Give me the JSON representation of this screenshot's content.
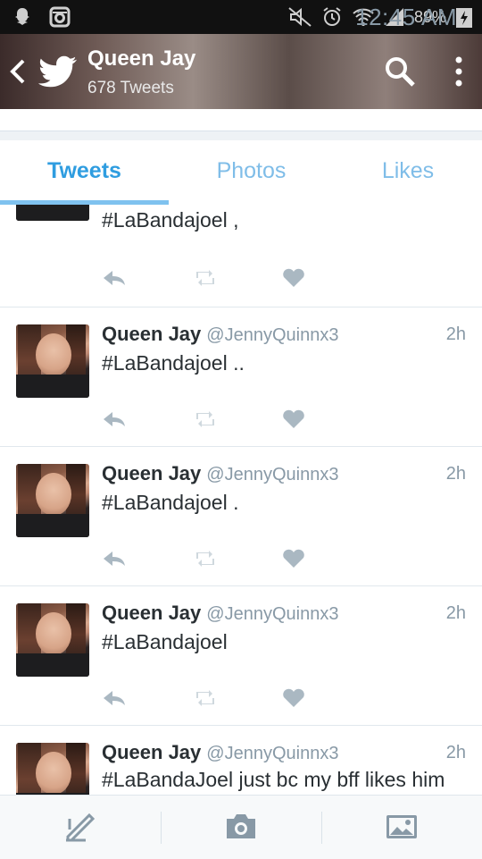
{
  "statusbar": {
    "battery": "89%",
    "time": "12:45 AM"
  },
  "header": {
    "title": "Queen Jay",
    "tweet_count": "678 Tweets"
  },
  "tabs": [
    {
      "label": "Tweets",
      "active": true
    },
    {
      "label": "Photos",
      "active": false
    },
    {
      "label": "Likes",
      "active": false
    }
  ],
  "tweets": [
    {
      "name": "",
      "handle": "",
      "time": "",
      "text": "#LaBandajoel ,"
    },
    {
      "name": "Queen Jay",
      "handle": "@JennyQuinnx3",
      "time": "2h",
      "text": "#LaBandajoel .."
    },
    {
      "name": "Queen Jay",
      "handle": "@JennyQuinnx3",
      "time": "2h",
      "text": "#LaBandajoel ."
    },
    {
      "name": "Queen Jay",
      "handle": "@JennyQuinnx3",
      "time": "2h",
      "text": "#LaBandajoel"
    },
    {
      "name": "Queen Jay",
      "handle": "@JennyQuinnx3",
      "time": "2h",
      "text": "#LaBandaJoel just bc my bff likes him"
    }
  ],
  "icons": {
    "status_left": [
      "snapchat-icon",
      "instagram-icon"
    ],
    "status_right": [
      "mute-icon",
      "alarm-icon",
      "wifi-icon",
      "signal-icon",
      "battery-charging-icon"
    ],
    "header": [
      "back-arrow-icon",
      "twitter-bird-icon",
      "search-icon",
      "more-vert-icon"
    ],
    "tweet_actions": [
      "reply-icon",
      "retweet-icon",
      "like-icon"
    ],
    "bottom": [
      "compose-icon",
      "camera-icon",
      "image-icon"
    ]
  },
  "colors": {
    "accent": "#2f9de0",
    "tab_inactive": "#7fbde8",
    "text": "#292f33",
    "muted": "#8899a6",
    "icon": "#aab8c2"
  }
}
